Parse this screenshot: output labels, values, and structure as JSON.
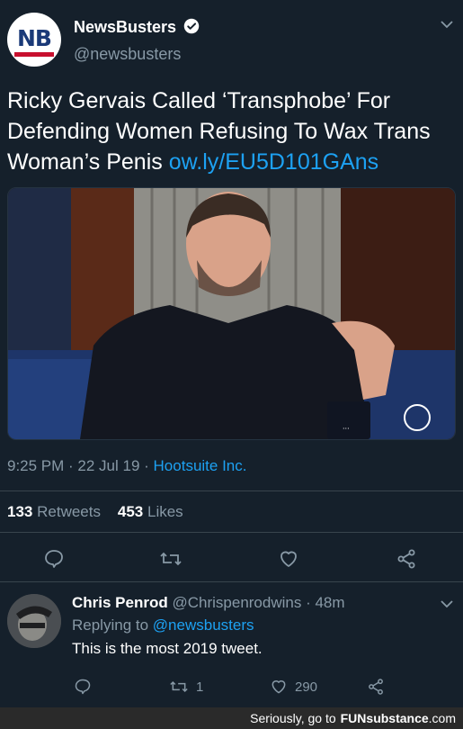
{
  "tweet": {
    "author_name": "NewsBusters",
    "author_handle": "@newsbusters",
    "avatar_text": "NB",
    "text": "Ricky Gervais Called ‘Transphobe’ For Defending Women Refusing To Wax Trans Woman’s Penis ",
    "link": "ow.ly/EU5D101GAns",
    "time": "9:25 PM",
    "date": "22 Jul 19",
    "source": "Hootsuite Inc.",
    "retweets_count": "133",
    "retweets_label": "Retweets",
    "likes_count": "453",
    "likes_label": "Likes"
  },
  "reply": {
    "author_name": "Chris Penrod",
    "author_handle": "@Chrispenrodwins",
    "time_ago": "48m",
    "replying_to_label": "Replying to",
    "replying_to_handle": "@newsbusters",
    "text": "This is the most 2019 tweet.",
    "retweet_count": "1",
    "like_count": "290"
  },
  "footer": {
    "text": "Seriously, go to",
    "brand_fun": "FUN",
    "brand_substance": "substance",
    "brand_domain": ".com"
  },
  "colors": {
    "background": "#15202b",
    "accent": "#1da1f2",
    "muted": "#8899a6"
  }
}
